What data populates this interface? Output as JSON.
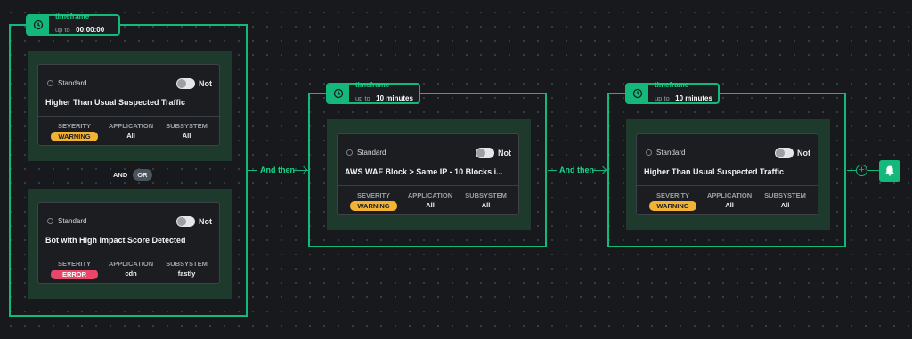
{
  "colors": {
    "accent": "#14b87a",
    "warning": "#f2b233",
    "error": "#e9476a",
    "background": "#17191c"
  },
  "group1": {
    "timeframe": {
      "label": "timeframe",
      "prefix": "up to",
      "value": "00:00:00",
      "icon": "clock-icon"
    },
    "operator": {
      "and": "AND",
      "or": "OR"
    },
    "alerts": [
      {
        "standard": "Standard",
        "not": "Not",
        "title": "Higher Than Usual Suspected Traffic",
        "severity_label": "SEVERITY",
        "severity": "WARNING",
        "application_label": "APPLICATION",
        "application": "All",
        "subsystem_label": "SUBSYSTEM",
        "subsystem": "All"
      },
      {
        "standard": "Standard",
        "not": "Not",
        "title": "Bot with High Impact Score Detected",
        "severity_label": "SEVERITY",
        "severity": "ERROR",
        "application_label": "APPLICATION",
        "application": "cdn",
        "subsystem_label": "SUBSYSTEM",
        "subsystem": "fastly"
      }
    ]
  },
  "connector1": {
    "label": "And then"
  },
  "group2": {
    "timeframe": {
      "label": "timeframe",
      "prefix": "up to",
      "value": "10 minutes",
      "icon": "clock-icon"
    },
    "alert": {
      "standard": "Standard",
      "not": "Not",
      "title": "AWS WAF Block > Same IP - 10 Blocks i...",
      "severity_label": "SEVERITY",
      "severity": "WARNING",
      "application_label": "APPLICATION",
      "application": "All",
      "subsystem_label": "SUBSYSTEM",
      "subsystem": "All"
    }
  },
  "connector2": {
    "label": "And then"
  },
  "group3": {
    "timeframe": {
      "label": "timeframe",
      "prefix": "up to",
      "value": "10 minutes",
      "icon": "clock-icon"
    },
    "alert": {
      "standard": "Standard",
      "not": "Not",
      "title": "Higher Than Usual Suspected Traffic",
      "severity_label": "SEVERITY",
      "severity": "WARNING",
      "application_label": "APPLICATION",
      "application": "All",
      "subsystem_label": "SUBSYSTEM",
      "subsystem": "All"
    }
  },
  "end": {
    "add_icon": "plus-icon",
    "notify_icon": "bell-icon"
  }
}
